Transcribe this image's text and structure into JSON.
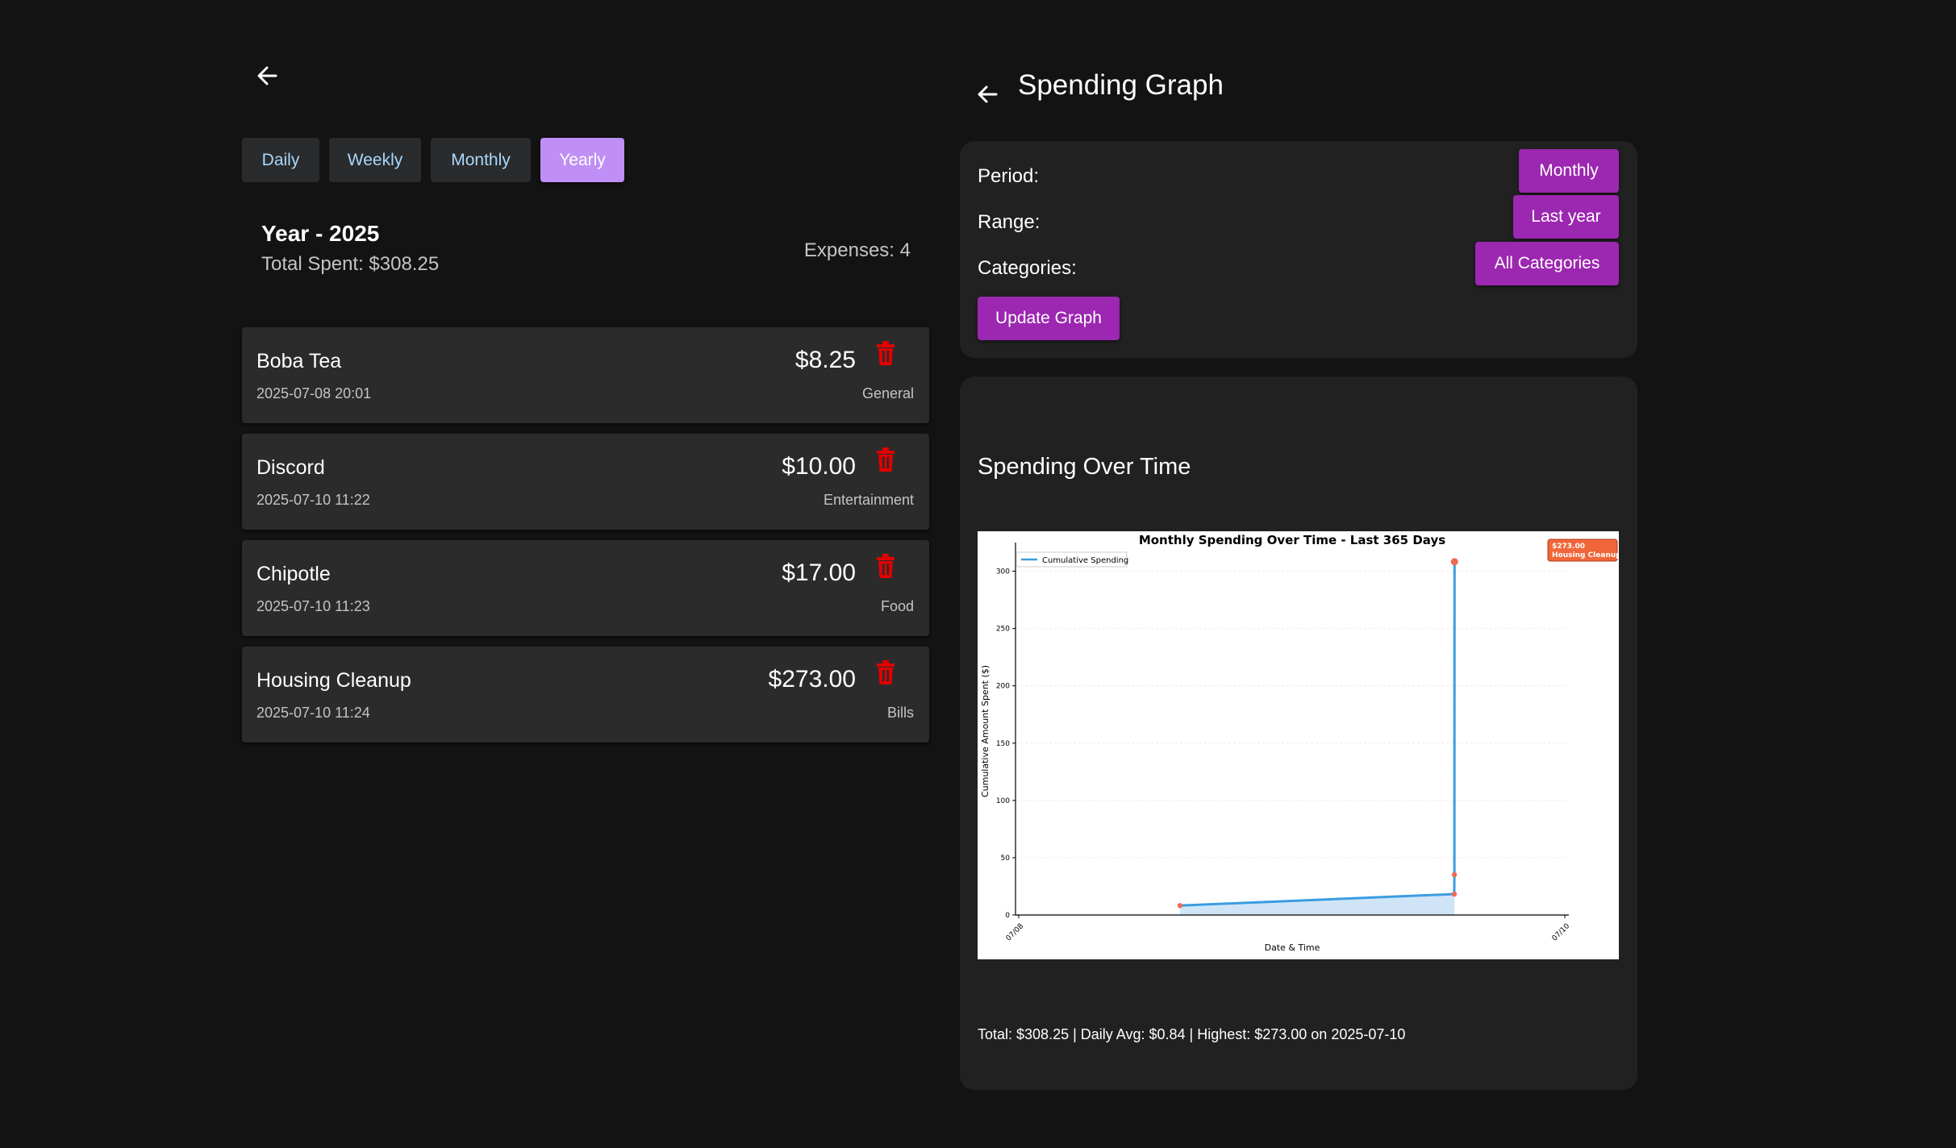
{
  "left": {
    "tabs": [
      {
        "label": "Daily",
        "active": false
      },
      {
        "label": "Weekly",
        "active": false
      },
      {
        "label": "Monthly",
        "active": false
      },
      {
        "label": "Yearly",
        "active": true
      }
    ],
    "summary": {
      "title": "Year - 2025",
      "total": "Total Spent: $308.25",
      "count": "Expenses: 4"
    },
    "expenses": [
      {
        "name": "Boba Tea",
        "date": "2025-07-08 20:01",
        "amount": "$8.25",
        "category": "General"
      },
      {
        "name": "Discord",
        "date": "2025-07-10 11:22",
        "amount": "$10.00",
        "category": "Entertainment"
      },
      {
        "name": "Chipotle",
        "date": "2025-07-10 11:23",
        "amount": "$17.00",
        "category": "Food"
      },
      {
        "name": "Housing Cleanup",
        "date": "2025-07-10 11:24",
        "amount": "$273.00",
        "category": "Bills"
      }
    ],
    "icons": {
      "back": "arrow-left-icon",
      "delete": "trash-icon"
    },
    "colors": {
      "active_tab": "#c08ff5",
      "tab_text": "#a8d8ff",
      "delete": "#e00000"
    }
  },
  "right": {
    "title": "Spending Graph",
    "filters": {
      "period_label": "Period:",
      "period_value": "Monthly",
      "range_label": "Range:",
      "range_value": "Last year",
      "categories_label": "Categories:",
      "categories_value": "All Categories",
      "update_button": "Update Graph"
    },
    "graph_heading": "Spending Over Time",
    "stats": "Total: $308.25 | Daily Avg: $0.84 | Highest: $273.00 on 2025-07-10",
    "colors": {
      "accent": "#9c27b0",
      "line": "#3a9de0",
      "marker": "#f06a50"
    }
  },
  "chart_data": {
    "type": "line",
    "title": "Monthly Spending Over Time - Last 365 Days",
    "xlabel": "Date & Time",
    "ylabel": "Cumulative Amount Spent ($)",
    "x_ticks": [
      "07/08",
      "07/10"
    ],
    "y_ticks": [
      0,
      50,
      100,
      150,
      200,
      250,
      300
    ],
    "ylim": [
      0,
      325
    ],
    "grid": true,
    "legend": "top-left",
    "series": [
      {
        "name": "Cumulative Spending",
        "x": [
          "2025-07-08 20:01",
          "2025-07-10 11:22",
          "2025-07-10 11:23",
          "2025-07-10 11:24"
        ],
        "values": [
          8.25,
          18.25,
          35.25,
          308.25
        ]
      }
    ],
    "annotation": {
      "line1": "$273.00",
      "line2": "Housing Cleanup"
    }
  }
}
